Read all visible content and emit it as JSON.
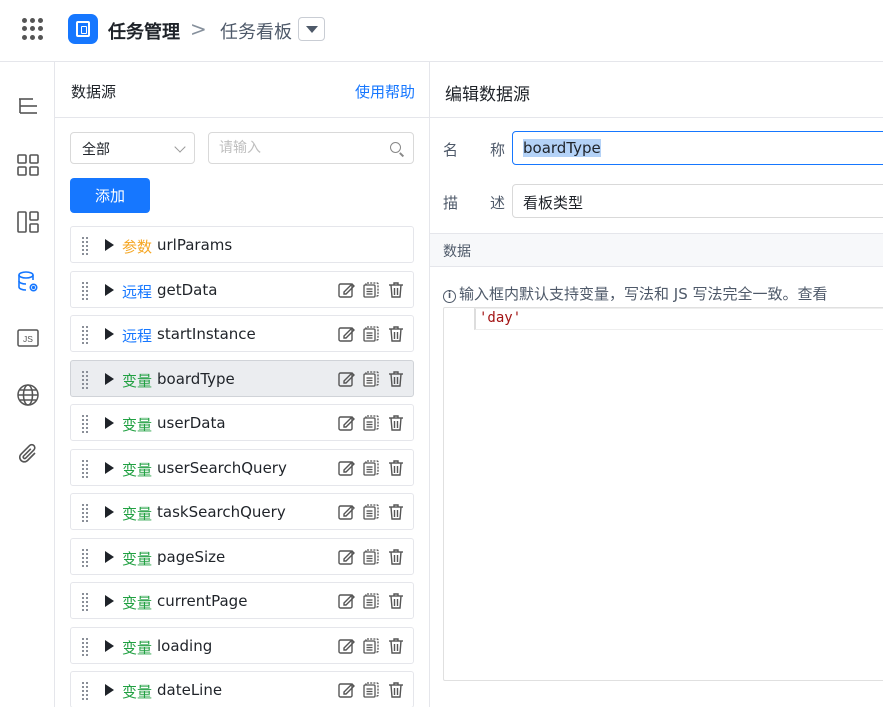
{
  "topbar": {
    "app_name": "任务管理",
    "separator": ">",
    "page_name": "任务看板"
  },
  "rail": {
    "items": [
      "outline-icon",
      "components-icon",
      "layout-icon",
      "datasource-icon",
      "js-icon",
      "globe-icon",
      "attachment-icon"
    ],
    "js_label": "JS",
    "active_color": "#1677ff"
  },
  "datasource": {
    "title": "数据源",
    "help_link": "使用帮助",
    "filter_value": "全部",
    "search_placeholder": "请输入",
    "add_button": "添加",
    "items": [
      {
        "kind": "参数",
        "kind_type": "param",
        "name": "urlParams",
        "actions": false,
        "selected": false
      },
      {
        "kind": "远程",
        "kind_type": "remote",
        "name": "getData",
        "actions": true,
        "selected": false
      },
      {
        "kind": "远程",
        "kind_type": "remote",
        "name": "startInstance",
        "actions": true,
        "selected": false
      },
      {
        "kind": "变量",
        "kind_type": "var",
        "name": "boardType",
        "actions": true,
        "selected": true
      },
      {
        "kind": "变量",
        "kind_type": "var",
        "name": "userData",
        "actions": true,
        "selected": false
      },
      {
        "kind": "变量",
        "kind_type": "var",
        "name": "userSearchQuery",
        "actions": true,
        "selected": false
      },
      {
        "kind": "变量",
        "kind_type": "var",
        "name": "taskSearchQuery",
        "actions": true,
        "selected": false
      },
      {
        "kind": "变量",
        "kind_type": "var",
        "name": "pageSize",
        "actions": true,
        "selected": false
      },
      {
        "kind": "变量",
        "kind_type": "var",
        "name": "currentPage",
        "actions": true,
        "selected": false
      },
      {
        "kind": "变量",
        "kind_type": "var",
        "name": "loading",
        "actions": true,
        "selected": false
      },
      {
        "kind": "变量",
        "kind_type": "var",
        "name": "dateLine",
        "actions": true,
        "selected": false
      }
    ]
  },
  "editor": {
    "title": "编辑数据源",
    "name_label_1": "名",
    "name_label_2": "称",
    "name_value": "boardType",
    "desc_label_1": "描",
    "desc_label_2": "述",
    "desc_value": "看板类型",
    "data_section": "数据",
    "hint": "输入框内默认支持变量，写法和 JS 写法完全一致。查看",
    "code_line": "'day'"
  },
  "colors": {
    "primary": "#1677ff",
    "param": "#f5a623",
    "remote": "#1677ff",
    "var": "#21a042"
  }
}
